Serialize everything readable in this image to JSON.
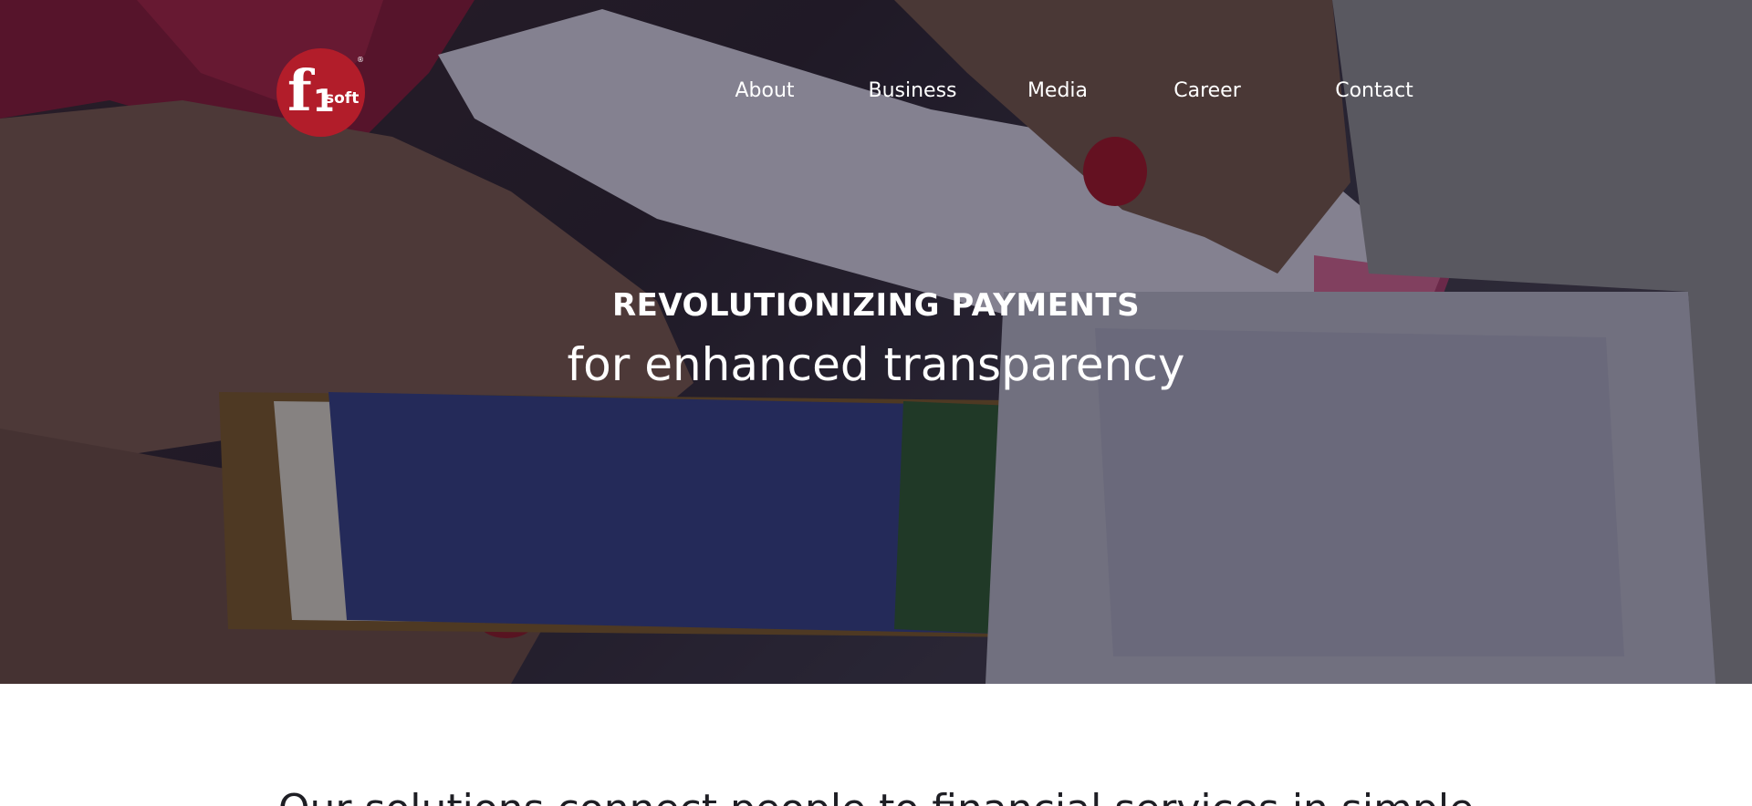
{
  "brand": {
    "logo_main": "f",
    "logo_one": "1",
    "logo_suffix": "soft",
    "logo_reg": "®",
    "accent_color": "#b21d2a"
  },
  "nav": {
    "items": [
      {
        "label": "About"
      },
      {
        "label": "Business"
      },
      {
        "label": "Media"
      },
      {
        "label": "Career"
      },
      {
        "label": "Contact"
      }
    ]
  },
  "hero": {
    "title": "REVOLUTIONIZING PAYMENTS",
    "subtitle": "for enhanced transparency"
  },
  "intro": {
    "text": "Our solutions connect people to financial services in simple"
  }
}
